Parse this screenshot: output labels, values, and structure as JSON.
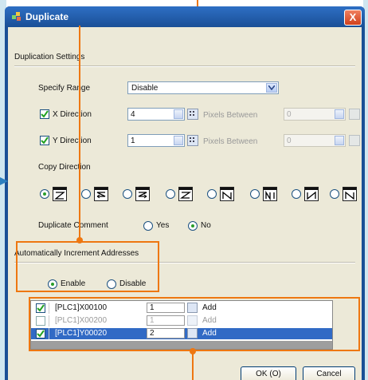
{
  "window": {
    "title": "Duplicate",
    "close_label": "X"
  },
  "duplication": {
    "group_label": "Duplication Settings",
    "specify_range": {
      "label": "Specify Range",
      "value": "Disable"
    },
    "x": {
      "label": "X Direction",
      "checked": true,
      "value": "4",
      "pixels_label": "Pixels Between",
      "pixels_value": "0"
    },
    "y": {
      "label": "Y Direction",
      "checked": true,
      "value": "1",
      "pixels_label": "Pixels Between",
      "pixels_value": "0"
    },
    "copy_direction_label": "Copy Direction",
    "copy_directions": [
      {
        "icon": "z-left-to-right-icon",
        "selected": true
      },
      {
        "icon": "z-reverse-icon",
        "selected": false
      },
      {
        "icon": "z-right-arrow-icon",
        "selected": false
      },
      {
        "icon": "z-left-arrow-icon",
        "selected": false
      },
      {
        "icon": "n-down-icon",
        "selected": false
      },
      {
        "icon": "n-variant-icon",
        "selected": false
      },
      {
        "icon": "n-reverse-icon",
        "selected": false
      },
      {
        "icon": "n-right-icon",
        "selected": false
      }
    ],
    "comment": {
      "label": "Duplicate Comment",
      "yes": "Yes",
      "no": "No",
      "selected": "No"
    }
  },
  "increment": {
    "label": "Automatically Increment Addresses",
    "enable": "Enable",
    "disable": "Disable",
    "selected": "Enable"
  },
  "address_rows": [
    {
      "checked": true,
      "address": "[PLC1]X00100",
      "step": "1",
      "mode": "Add",
      "selected": false,
      "disabled": false
    },
    {
      "checked": false,
      "address": "[PLC1]X00200",
      "step": "1",
      "mode": "Add",
      "selected": false,
      "disabled": true
    },
    {
      "checked": true,
      "address": "[PLC1]Y00020",
      "step": "2",
      "mode": "Add",
      "selected": true,
      "disabled": false
    }
  ],
  "buttons": {
    "ok": "OK (O)",
    "cancel": "Cancel"
  },
  "colors": {
    "callout": "#ee7711",
    "title_bar": "#1a4f96",
    "selection": "#316ac5"
  }
}
